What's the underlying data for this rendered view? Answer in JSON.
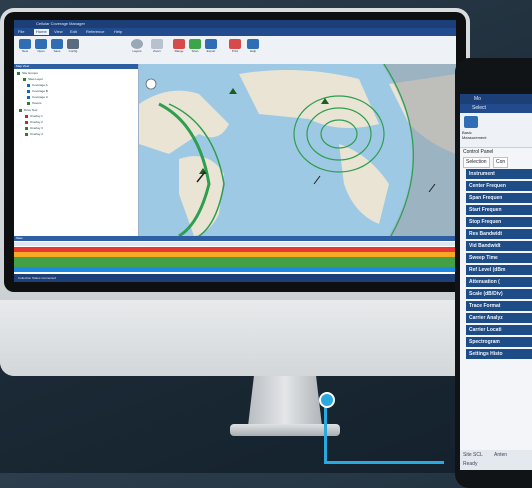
{
  "desktop_app": {
    "window_title": "Cellular Coverage Manager",
    "menu_tabs": [
      "File",
      "Home",
      "View",
      "Edit",
      "Reference",
      "Help"
    ],
    "ribbon_buttons": [
      "New",
      "Open",
      "Save",
      "Config",
      "Layers",
      "Zoom",
      "Range",
      "Scan",
      "Export",
      "Print",
      "Help"
    ],
    "tree_title": "Map View",
    "tree_items": [
      {
        "label": "Site Groups",
        "color": "#2e7d32"
      },
      {
        "label": "Sites Layer",
        "color": "#2e7d32"
      },
      {
        "label": "Coverage A",
        "color": "#1565c0"
      },
      {
        "label": "Coverage B",
        "color": "#1565c0"
      },
      {
        "label": "Coverage C",
        "color": "#1565c0"
      },
      {
        "label": "Towers",
        "color": "#2e7d32"
      },
      {
        "label": "Drive Test",
        "color": "#2e7d32"
      },
      {
        "label": "Overlay 1",
        "color": "#c62828"
      },
      {
        "label": "Overlay 2",
        "color": "#c62828"
      },
      {
        "label": "Overlay 3",
        "color": "#2e7d32"
      },
      {
        "label": "Overlay 4",
        "color": "#2e7d32"
      }
    ],
    "grid_title": "Sites",
    "grid_rows": [
      {
        "color": "#e53935"
      },
      {
        "color": "#f9a825"
      },
      {
        "color": "#43a047"
      },
      {
        "color": "#43a047"
      },
      {
        "color": "#1e88e5"
      }
    ],
    "status_text": "Collection Status Connected"
  },
  "tablet_app": {
    "title": "Mo",
    "select_tab": "Select",
    "ribbon_label": "Basic Measurement",
    "panel_label": "Control Panel",
    "tabs": [
      "Selection",
      "Con"
    ],
    "items": [
      "Instrument",
      "Center Frequen",
      "Span Frequen",
      "Start Frequen",
      "Stop Frequen",
      "Res Bandwidt",
      "Vid Bandwidt",
      "Sweep Time",
      "Ref Level (dBm",
      "Attenuation (",
      "Scale (dB/Div)",
      "Trace Format",
      "Carrier Analyz",
      "Carrier Locati",
      "Spectrogram",
      "Settings Histo"
    ],
    "footer_left": "Site SCL",
    "footer_right": "Anten",
    "footer_status": "Ready"
  },
  "colors": {
    "accent": "#29a9e0",
    "app_blue": "#1e4c86"
  }
}
